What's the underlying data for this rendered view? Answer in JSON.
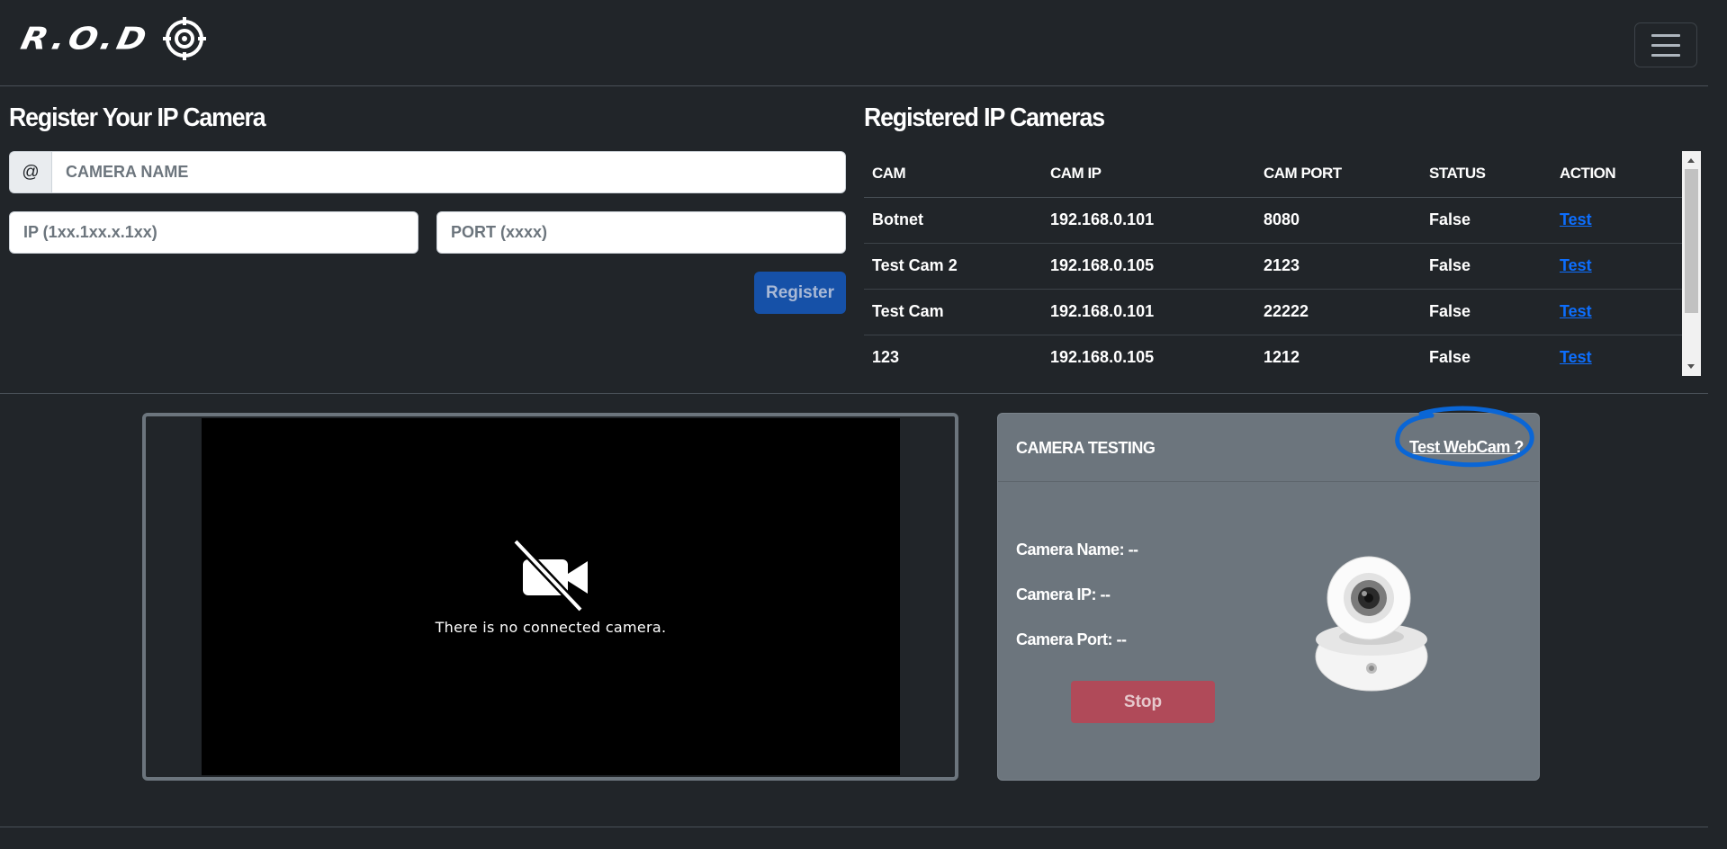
{
  "navbar": {
    "brand": "R.O.D",
    "brand_icon": "crosshair-icon",
    "toggler_icon": "hamburger-menu-icon"
  },
  "register": {
    "title": "Register Your IP Camera",
    "prefix": "@",
    "name_placeholder": "CAMERA NAME",
    "ip_placeholder": "IP (1xx.1xx.x.1xx)",
    "port_placeholder": "PORT (xxxx)",
    "button": "Register"
  },
  "registered": {
    "title": "Registered IP Cameras",
    "columns": [
      "CAM",
      "CAM IP",
      "CAM PORT",
      "STATUS",
      "ACTION"
    ],
    "rows": [
      {
        "cam": "Botnet",
        "ip": "192.168.0.101",
        "port": "8080",
        "status": "False",
        "action": "Test"
      },
      {
        "cam": "Test Cam 2",
        "ip": "192.168.0.105",
        "port": "2123",
        "status": "False",
        "action": "Test"
      },
      {
        "cam": "Test Cam",
        "ip": "192.168.0.101",
        "port": "22222",
        "status": "False",
        "action": "Test"
      },
      {
        "cam": "123",
        "ip": "192.168.0.105",
        "port": "1212",
        "status": "False",
        "action": "Test"
      }
    ]
  },
  "video": {
    "message": "There is no connected camera.",
    "icon": "video-off-icon"
  },
  "testing": {
    "title": "CAMERA TESTING",
    "webcam_link": "Test WebCam ?",
    "camera_name": "Camera Name: --",
    "camera_ip": "Camera IP: --",
    "camera_port": "Camera Port: --",
    "stop_button": "Stop",
    "image_icon": "webcam-icon"
  },
  "colors": {
    "background": "#212529",
    "primary": "#1651a8",
    "link": "#0d6efd",
    "danger": "#b04a59",
    "card": "#6c757d",
    "annotation": "#0a66d6"
  }
}
